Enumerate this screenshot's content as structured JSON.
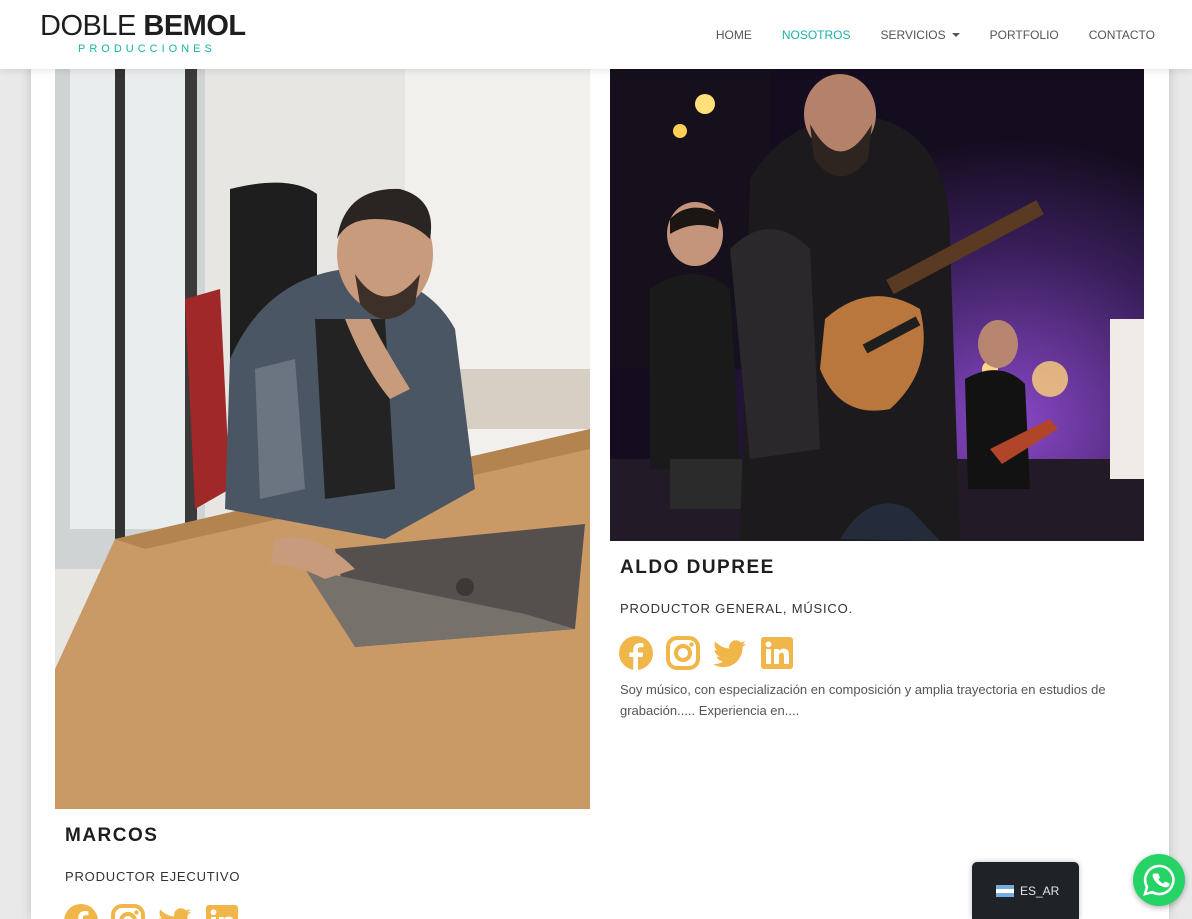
{
  "brand": {
    "logo_line1": "DOBLE ",
    "logo_line2": "BEMOL",
    "logo_sub": "PRODUCCIONES",
    "accent_color": "#19b3a5"
  },
  "nav": {
    "items": [
      {
        "label": "HOME"
      },
      {
        "label": "NOSOTROS",
        "active": true
      },
      {
        "label": "SERVICIOS",
        "has_dropdown": true
      },
      {
        "label": "PORTFOLIO"
      },
      {
        "label": "CONTACTO"
      }
    ]
  },
  "team": [
    {
      "name": "MARCOS",
      "role": "PRODUCTOR EJECUTIVO",
      "photo": "man-with-laptop-at-desk",
      "socials": [
        "facebook-icon",
        "instagram-icon",
        "twitter-icon",
        "linkedin-icon"
      ],
      "bio": ""
    },
    {
      "name": "ALDO DUPREE",
      "role": "PRODUCTOR GENERAL, MÚSICO.",
      "photo": "bassist-on-stage",
      "socials": [
        "facebook-icon",
        "instagram-icon",
        "twitter-icon",
        "linkedin-icon"
      ],
      "bio": "Soy músico, con especialización en composición y amplia trayectoria en estudios de grabación..... Experiencia en...."
    }
  ],
  "social_color": "#f0b64a",
  "language": {
    "label": "ES_AR",
    "flag": "argentina-flag"
  },
  "whatsapp": {
    "icon": "whatsapp-icon",
    "color": "#25d366"
  }
}
